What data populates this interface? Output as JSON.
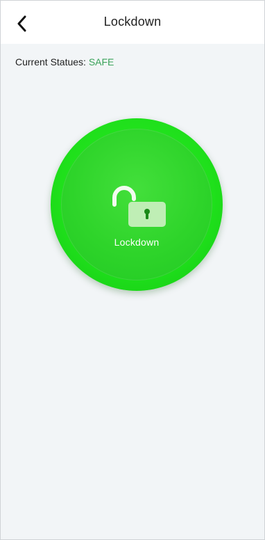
{
  "header": {
    "title": "Lockdown",
    "back_icon": "chevron-left-icon"
  },
  "status": {
    "label": "Current Statues: ",
    "value": "SAFE",
    "value_color": "#3aa35a"
  },
  "lockdown_button": {
    "label": "Lockdown",
    "icon": "unlocked-padlock-icon",
    "color": "#22d61f"
  }
}
